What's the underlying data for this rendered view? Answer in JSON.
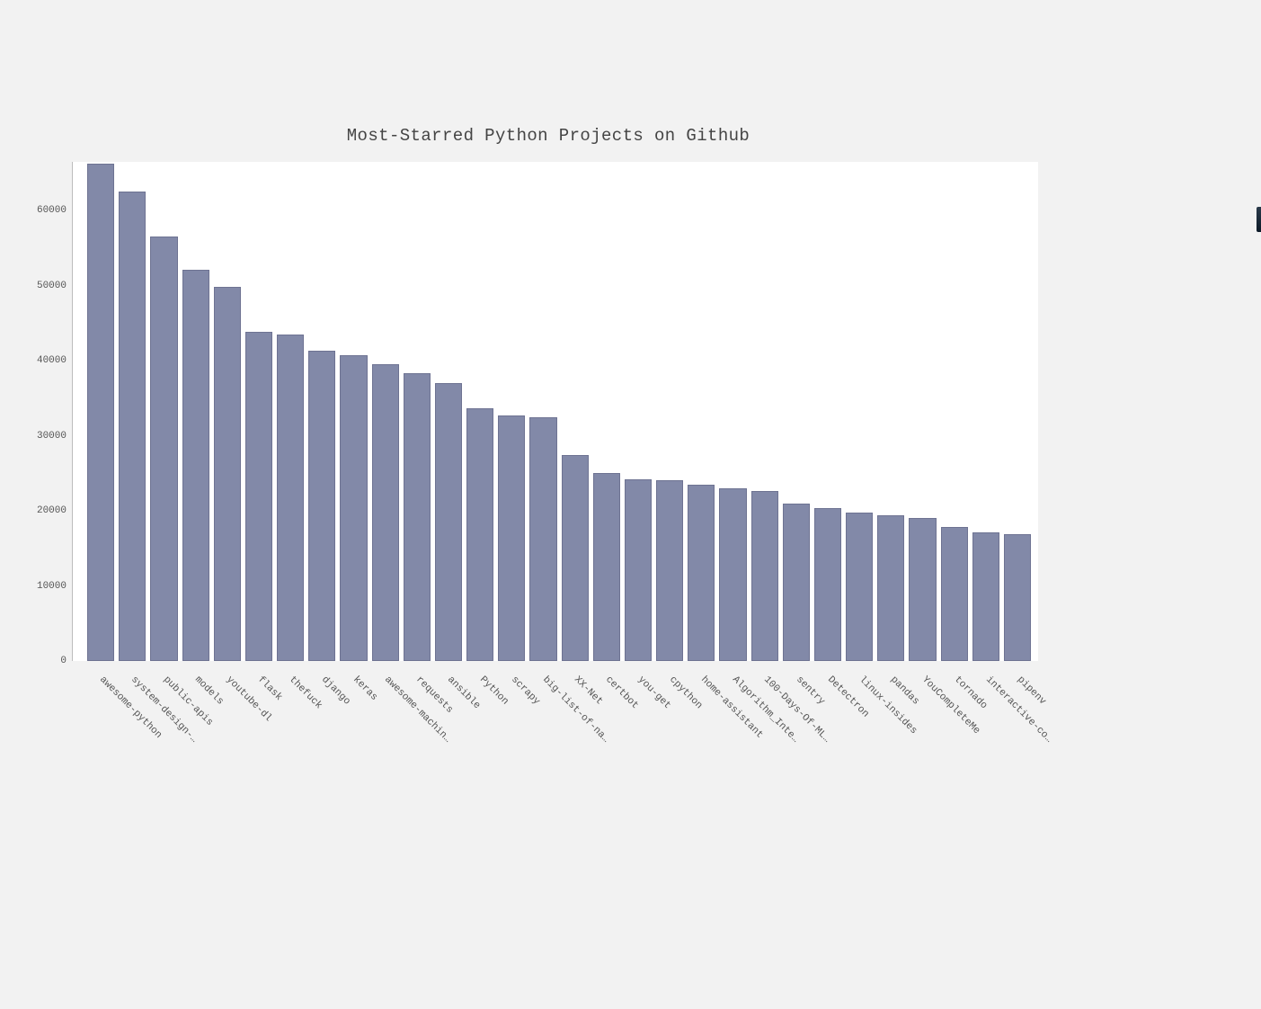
{
  "chart_data": {
    "type": "bar",
    "title": "Most-Starred Python Projects on Github",
    "xlabel": "",
    "ylabel": "",
    "ylim": [
      0,
      66500
    ],
    "y_ticks": [
      0,
      10000,
      20000,
      30000,
      40000,
      50000,
      60000
    ],
    "categories": [
      "awesome-python",
      "system-design-…",
      "public-apis",
      "models",
      "youtube-dl",
      "flask",
      "thefuck",
      "django",
      "keras",
      "awesome-machin…",
      "requests",
      "ansible",
      "Python",
      "scrapy",
      "big-list-of-na…",
      "XX-Net",
      "certbot",
      "you-get",
      "cpython",
      "home-assistant",
      "Algorithm_Inte…",
      "100-Days-Of-ML…",
      "sentry",
      "Detectron",
      "linux-insides",
      "pandas",
      "YouCompleteMe",
      "tornado",
      "interactive-co…",
      "pipenv"
    ],
    "values": [
      66300,
      62500,
      56500,
      52100,
      49900,
      43900,
      43500,
      41300,
      40700,
      39600,
      38400,
      37000,
      33700,
      32700,
      32500,
      27400,
      25000,
      24200,
      24100,
      23500,
      23000,
      22700,
      21000,
      20400,
      19800,
      19400,
      19000,
      17800,
      17100,
      16900
    ]
  }
}
